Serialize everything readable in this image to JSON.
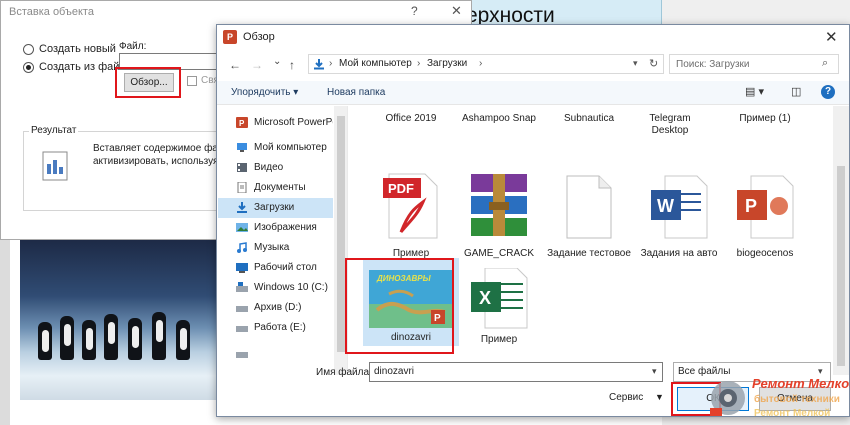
{
  "slide": {
    "title_fragment": "ерхности"
  },
  "insert_dialog": {
    "title": "Вставка объекта",
    "help": "?",
    "close": "✕",
    "radio_new": "Создать новый",
    "radio_from_file": "Создать из файла",
    "file_label": "Файл:",
    "browse_button": "Обзор...",
    "link_label": "Свя",
    "result_caption": "Результат",
    "result_line1": "Вставляет содержимое файла в",
    "result_line2": "активизировать, используя сп"
  },
  "browse_dialog": {
    "app_icon_letter": "P",
    "title": "Обзор",
    "close": "✕",
    "nav_back": "←",
    "nav_forward": "→",
    "nav_recent": "⌄",
    "nav_up": "↑",
    "address": [
      "Мой компьютер",
      "Загрузки"
    ],
    "address_separator": "›",
    "search_placeholder": "Поиск: Загрузки",
    "toolbar": {
      "organize": "Упорядочить ▾",
      "new_folder": "Новая папка",
      "help": "?"
    },
    "nav_items": [
      {
        "label": "Microsoft PowerPoint",
        "icon": "powerpoint-icon"
      },
      {
        "label": "Мой компьютер",
        "icon": "computer-icon"
      },
      {
        "label": "Видео",
        "icon": "video-icon"
      },
      {
        "label": "Документы",
        "icon": "documents-icon"
      },
      {
        "label": "Загрузки",
        "icon": "downloads-icon"
      },
      {
        "label": "Изображения",
        "icon": "pictures-icon"
      },
      {
        "label": "Музыка",
        "icon": "music-icon"
      },
      {
        "label": "Рабочий стол",
        "icon": "desktop-icon"
      },
      {
        "label": "Windows 10 (C:)",
        "icon": "drive-icon"
      },
      {
        "label": "Архив (D:)",
        "icon": "drive-icon"
      },
      {
        "label": "Работа (E:)",
        "icon": "drive-icon"
      }
    ],
    "top_row_labels": [
      "Office 2019",
      "Ashampoo Snap",
      "Subnautica",
      "Telegram Desktop",
      "Пример (1)"
    ],
    "files": [
      {
        "name": "Пример",
        "type": "pdf-icon"
      },
      {
        "name": "GAME_CRACK",
        "type": "winrar-icon"
      },
      {
        "name": "Задание тестовое",
        "type": "text-document-icon"
      },
      {
        "name": "Задания на авто",
        "type": "word-icon"
      },
      {
        "name": "biogeocenos",
        "type": "powerpoint-file-icon"
      },
      {
        "name": "dinozavri",
        "type": "powerpoint-thumbnail-icon",
        "thumb_text": "ДИНОЗАВРЫ"
      },
      {
        "name": "Пример",
        "type": "excel-icon"
      }
    ],
    "filename_label": "Имя файла:",
    "filename_value": "dinozavri",
    "filetype_value": "Все файлы",
    "service_label": "Сервис",
    "ok_label": "ОК",
    "cancel_label": "Отмена"
  },
  "watermark": {
    "line1": "Ремонт Мелкой",
    "line2": "бытовой техники",
    "line3": "Ремонт Мелкой"
  },
  "colors": {
    "highlight_red": "#e0161b",
    "selection_blue": "#cce4f7",
    "accent_blue": "#0078d7"
  }
}
